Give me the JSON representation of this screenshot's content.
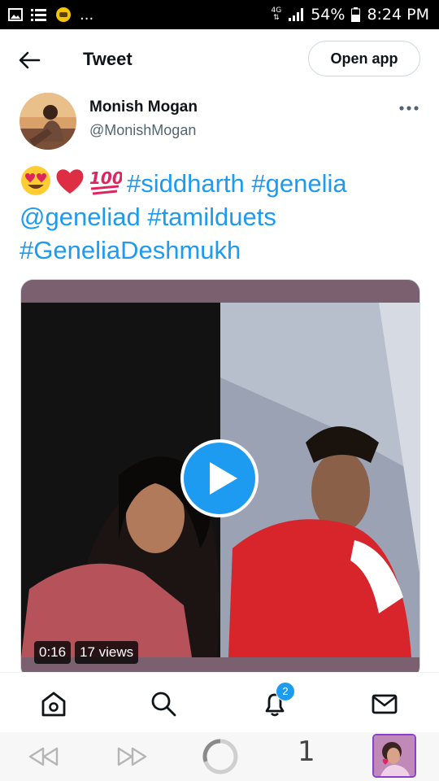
{
  "status_bar": {
    "network": "4G",
    "battery": "54%",
    "time": "8:24 PM",
    "overflow": "..."
  },
  "header": {
    "title": "Tweet",
    "open_app_label": "Open app"
  },
  "author": {
    "name": "Monish Mogan",
    "handle": "@MonishMogan"
  },
  "tweet": {
    "emojis": [
      "smiling-face-with-heart-eyes",
      "red-heart",
      "hundred-points"
    ],
    "tags": [
      "#siddharth",
      "#genelia",
      "@geneliad",
      "#tamilduets",
      "#GeneliaDeshmukh"
    ]
  },
  "media": {
    "duration": "0:16",
    "views": "17 views"
  },
  "bottom_nav": {
    "notification_count": "2",
    "items": [
      "home-icon",
      "search-icon",
      "notifications-icon",
      "messages-icon"
    ]
  },
  "browser_bar": {
    "tab_count": "1"
  },
  "colors": {
    "accent": "#1d9bf0",
    "text": "#0f1419",
    "secondary": "#536471"
  }
}
